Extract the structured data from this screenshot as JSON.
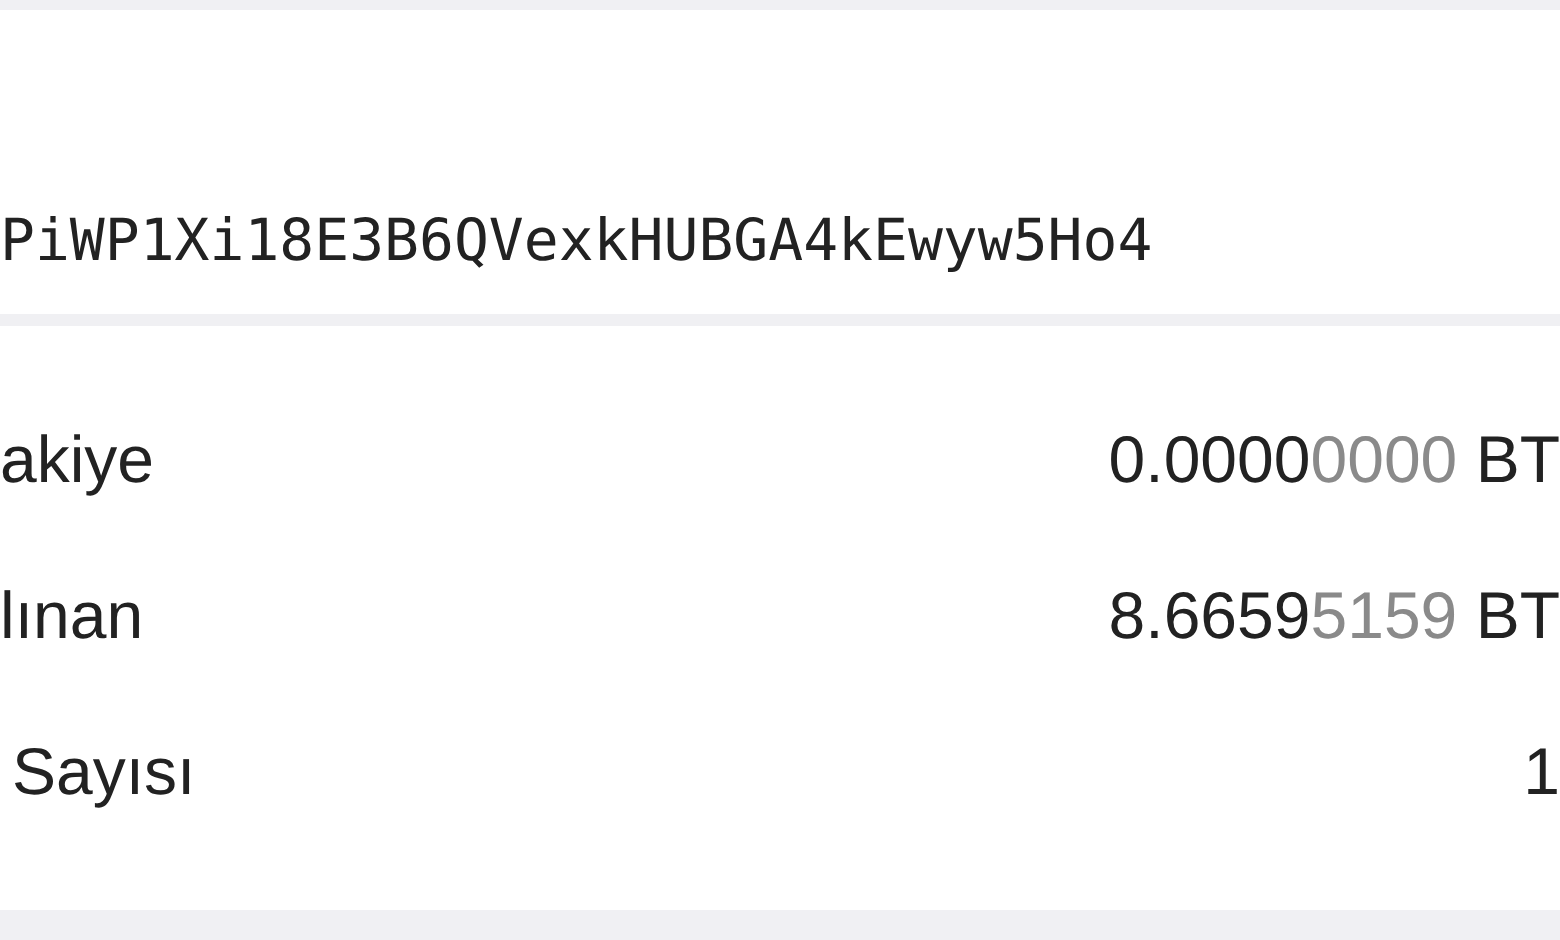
{
  "address": {
    "text": "PiWP1Xi18E3B6QVexkHUBGA4kEwyw5Ho4"
  },
  "rows": [
    {
      "label": "akiye",
      "value_main": "0.0000",
      "value_dim": "0000",
      "unit": "BT"
    },
    {
      "label": "lınan",
      "value_main": "8.6659",
      "value_dim": "5159",
      "unit": "BT"
    },
    {
      "label": "Sayısı",
      "value_main": "1"
    }
  ]
}
